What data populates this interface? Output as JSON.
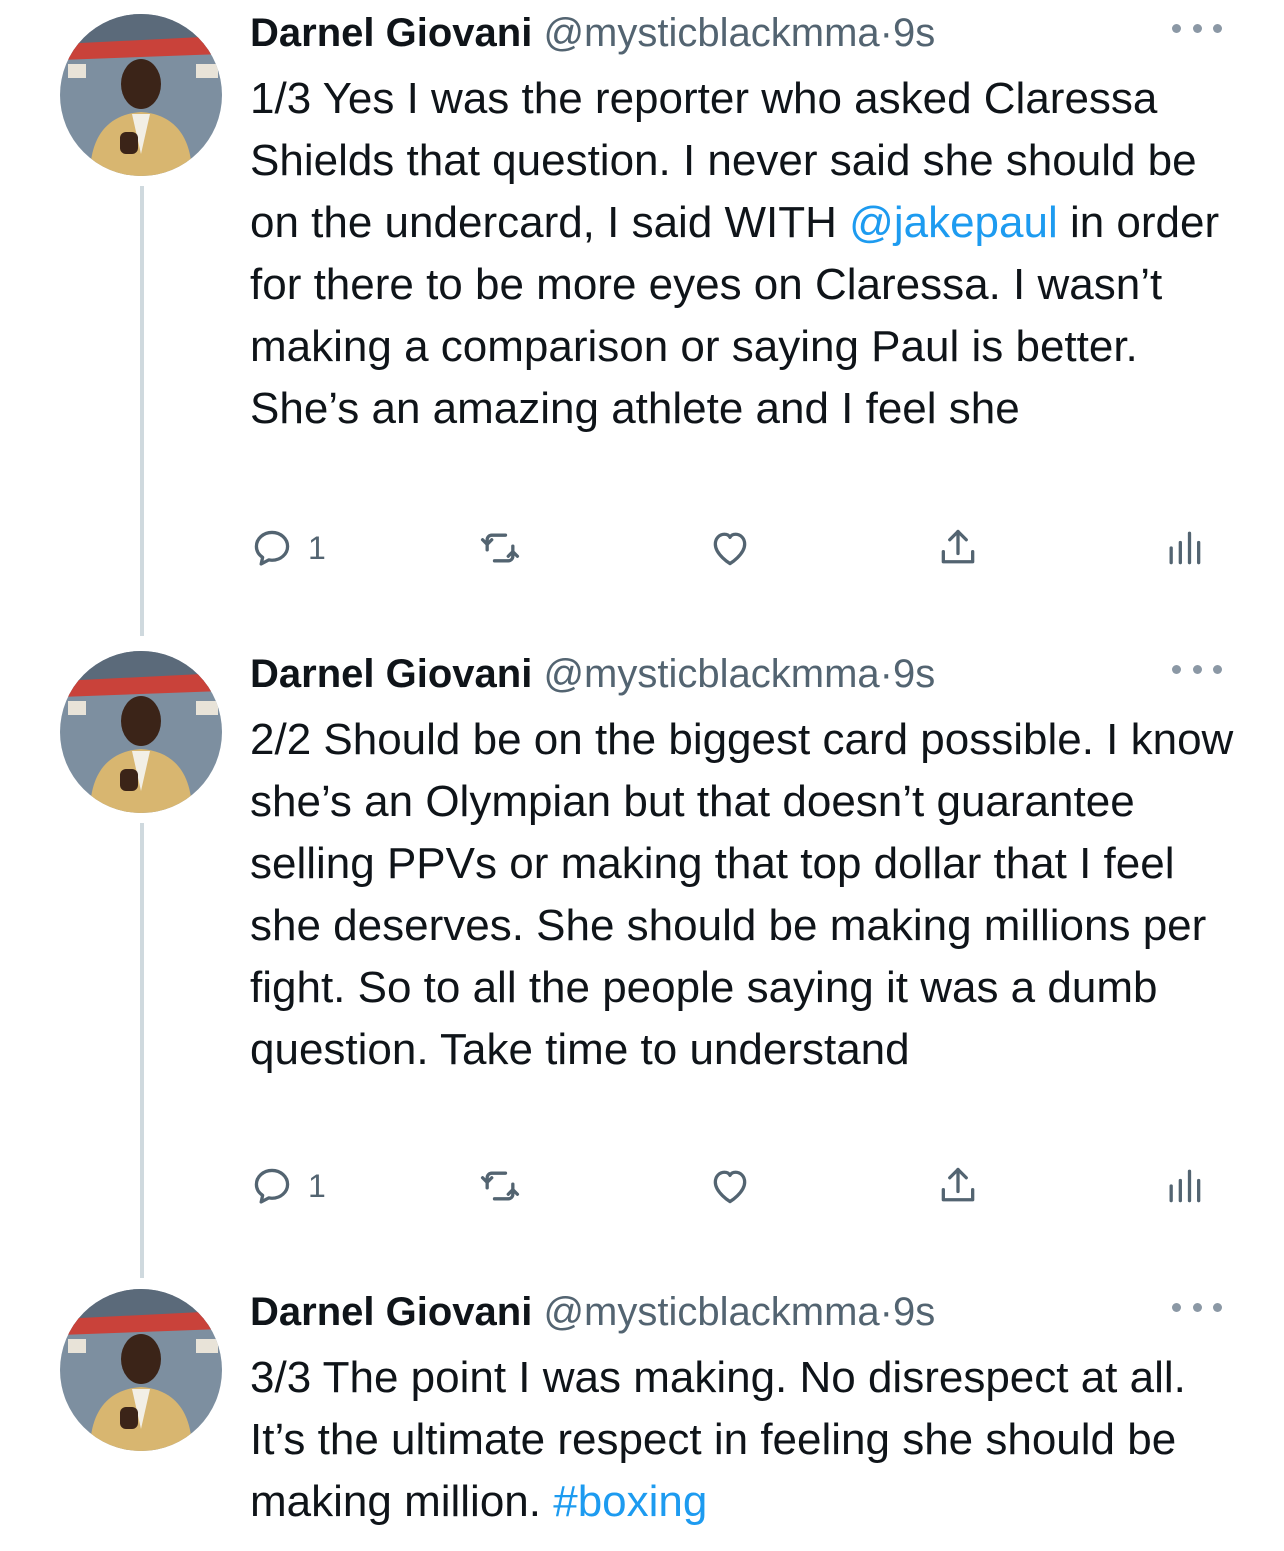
{
  "tweets": [
    {
      "name": "Darnel Giovani",
      "handle": "@mysticblackmma",
      "dot": "·",
      "time": "9s",
      "text_before": "1/3 Yes I was the reporter who asked Claressa Shields that question. I never said she should be on the undercard, I said WITH ",
      "link": "@jakepaul",
      "text_after": " in order for there to be more eyes on Claressa. I wasn’t making a comparison or saying Paul is better. She’s an amazing athlete and I feel she",
      "reply_count": "1"
    },
    {
      "name": "Darnel Giovani",
      "handle": "@mysticblackmma",
      "dot": "·",
      "time": "9s",
      "text_before": "2/2 Should be on the biggest card possible. I know she’s an Olympian but that doesn’t guarantee selling PPVs or making that top dollar that I feel she deserves. She should be making millions per fight. So to all the people saying it was a dumb question. Take time to understand",
      "link": "",
      "text_after": "",
      "reply_count": "1"
    },
    {
      "name": "Darnel Giovani",
      "handle": "@mysticblackmma",
      "dot": "·",
      "time": "9s",
      "text_before": "3/3 The point I was making. No disrespect at all. It’s the ultimate respect in feeling she should be making million. ",
      "link": "#boxing",
      "text_after": "",
      "reply_count": ""
    }
  ],
  "icons": {
    "reply": "reply-icon",
    "retweet": "retweet-icon",
    "like": "heart-icon",
    "share": "share-icon",
    "analytics": "analytics-icon",
    "more": "more-icon"
  },
  "colors": {
    "text": "#0f1419",
    "secondary": "#536471",
    "link": "#1d9bf0",
    "thread_line": "#cfd9de"
  }
}
